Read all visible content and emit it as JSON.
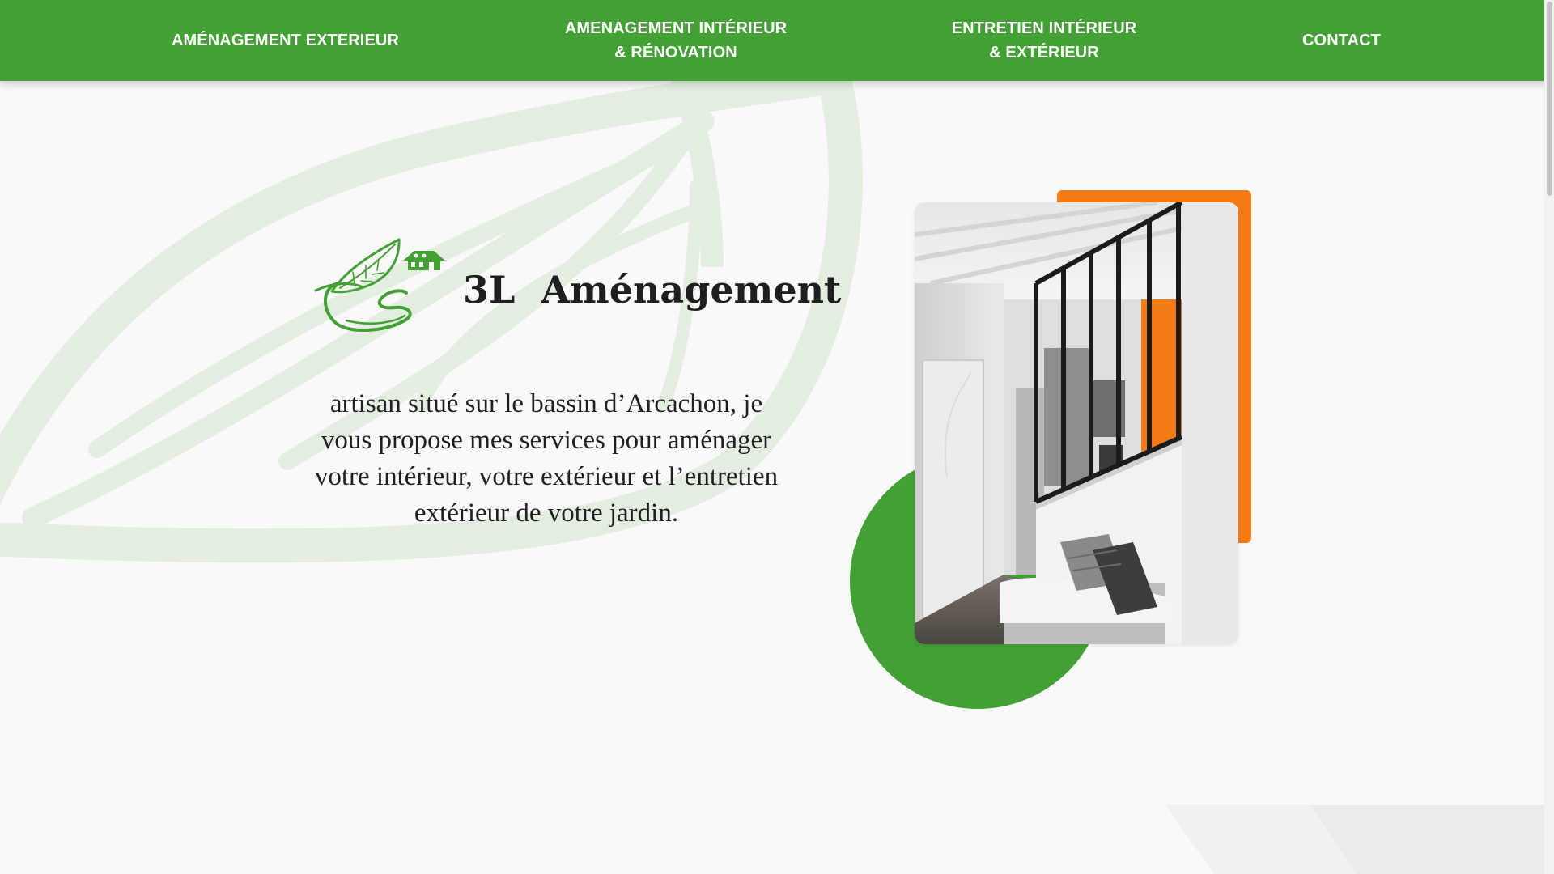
{
  "nav": {
    "items": [
      {
        "lines": [
          "AMÉNAGEMENT EXTERIEUR"
        ]
      },
      {
        "lines": [
          "AMENAGEMENT INTÉRIEUR",
          "& RÉNOVATION"
        ]
      },
      {
        "lines": [
          "ENTRETIEN INTÉRIEUR",
          "& EXTÉRIEUR"
        ]
      },
      {
        "lines": [
          "CONTACT"
        ]
      }
    ]
  },
  "hero": {
    "brand_prefix": "3L",
    "brand_name": "Aménagement",
    "intro": "artisan situé sur le bassin d’Arcachon, je vous propose mes services pour aménager votre intérieur, votre extérieur et l’entretien extérieur de votre jardin."
  },
  "colors": {
    "brand_green": "#42a035",
    "accent_orange": "#f57c14",
    "background": "#f9f9f9",
    "leaf_watermark": "#e4eee2"
  },
  "icons": {
    "logo": "leaf-house-logo-icon",
    "background": "leaf-watermark-icon"
  }
}
